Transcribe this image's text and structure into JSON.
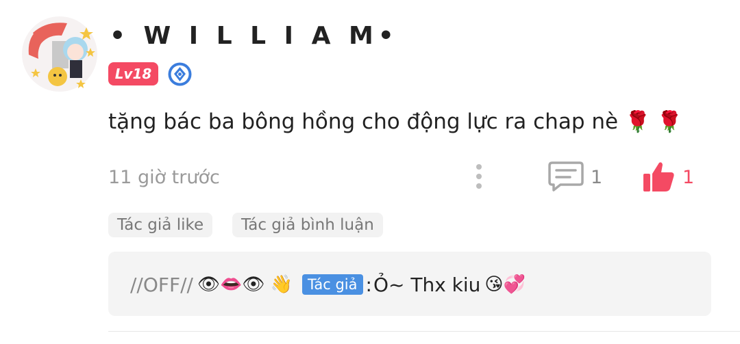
{
  "comment": {
    "username": "• W I L L I A M•",
    "level": "Lv18",
    "text": "tặng bác ba bông hồng cho động lực ra chap nè",
    "text_emojis": "🌹 🌹",
    "timestamp": "11 giờ trước",
    "reply_count": "1",
    "like_count": "1",
    "colors": {
      "accent": "#f44a63",
      "author_badge": "#4a90e2",
      "muted": "#9a9a9a"
    }
  },
  "tags": {
    "author_like": "Tác giả like",
    "author_reply": "Tác giả bình luận"
  },
  "reply": {
    "user": "//OFF//",
    "user_emojis": "👁👄👁 👋",
    "author_badge": "Tác giả",
    "separator": ":",
    "text": "Ỏ~ Thx kiu",
    "text_emojis": "😘💞"
  }
}
